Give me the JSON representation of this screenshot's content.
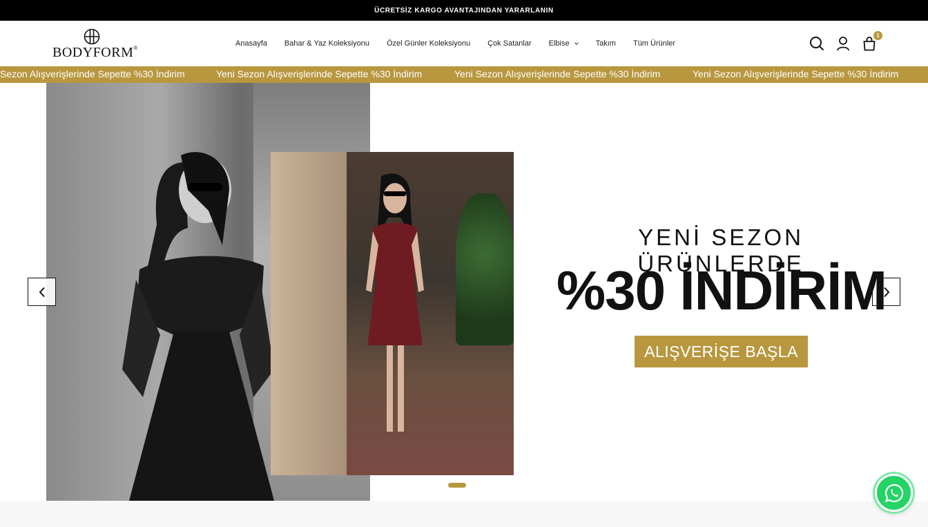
{
  "announcement": "ÜCRETSİZ KARGO AVANTAJINDAN YARARLANIN",
  "brand": {
    "name": "BODYFORM",
    "reg": "®"
  },
  "nav": [
    {
      "label": "Anasayfa"
    },
    {
      "label": "Bahar & Yaz Koleksiyonu"
    },
    {
      "label": "Özel Günler Koleksiyonu"
    },
    {
      "label": "Çok Satanlar"
    },
    {
      "label": "Elbise",
      "has_dropdown": true
    },
    {
      "label": "Takım"
    },
    {
      "label": "Tüm Ürünler"
    }
  ],
  "header_icons": [
    "search-icon",
    "user-icon",
    "cart-icon"
  ],
  "cart_count": "1",
  "ticker_text": "Yeni Sezon Alışverişlerinde Sepette %30 İndirim",
  "ticker_partial": "Sezon Alışverişlerinde Sepette %30 İndirim",
  "hero": {
    "headline": "YENİ SEZON ÜRÜNLERDE",
    "discount": "%30 İNDİRİM",
    "cta": "ALIŞVERİŞE BAŞLA"
  },
  "colors": {
    "accent": "#b8973f",
    "topbar": "#000000",
    "whatsapp": "#25d366"
  }
}
